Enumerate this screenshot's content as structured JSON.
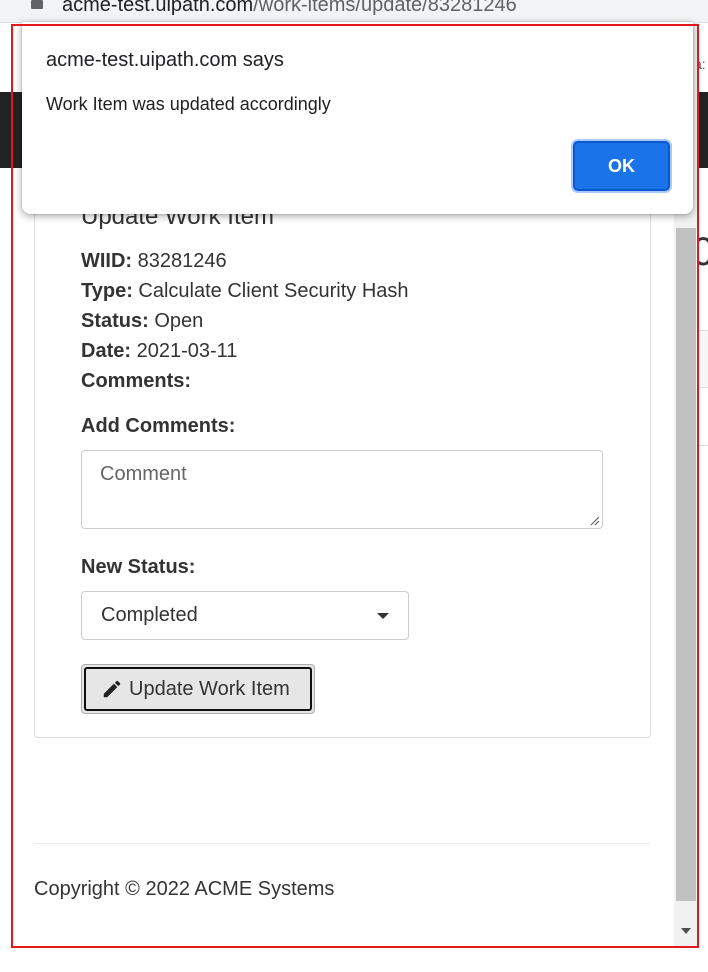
{
  "browser": {
    "url_host": "acme-test.uipath.com",
    "url_path": "/work-items/update/83281246",
    "right_edge_fragment": "a:"
  },
  "dialog": {
    "title": "acme-test.uipath.com says",
    "message": "Work Item was updated accordingly",
    "ok_label": "OK",
    "accent_color": "#1a73e8"
  },
  "panel": {
    "title": "Update Work Item",
    "wiid_label": "WIID:",
    "wiid_value": "83281246",
    "type_label": "Type:",
    "type_value": "Calculate Client Security Hash",
    "status_label": "Status:",
    "status_value": "Open",
    "date_label": "Date:",
    "date_value": "2021-03-11",
    "comments_label": "Comments:",
    "add_comments_label": "Add Comments:",
    "comment_placeholder": "Comment",
    "comment_value": "",
    "new_status_label": "New Status:",
    "new_status_selected": "Completed",
    "update_button_label": "Update Work Item",
    "update_button_icon": "pencil-icon"
  },
  "page_fragments": {
    "right_heading_glyph": "0"
  },
  "footer": {
    "copyright": "Copyright © 2022 ACME Systems"
  }
}
